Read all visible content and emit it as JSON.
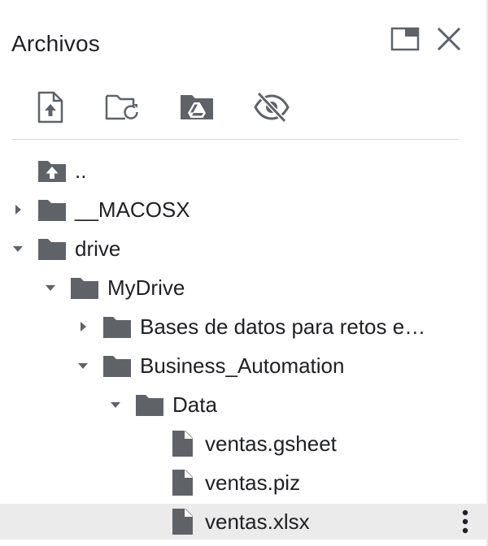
{
  "panel": {
    "title": "Archivos",
    "window_controls": [
      {
        "name": "maximize-icon"
      },
      {
        "name": "close-icon"
      }
    ]
  },
  "toolbar": {
    "buttons": [
      {
        "name": "upload-file-icon"
      },
      {
        "name": "refresh-folder-icon"
      },
      {
        "name": "mount-drive-icon"
      },
      {
        "name": "toggle-hidden-files-icon"
      }
    ]
  },
  "tree": {
    "items": [
      {
        "label": "..",
        "type": "parent-folder",
        "depth": 0,
        "expander": "none"
      },
      {
        "label": "__MACOSX",
        "type": "folder",
        "depth": 0,
        "expander": "collapsed"
      },
      {
        "label": "drive",
        "type": "folder",
        "depth": 0,
        "expander": "expanded"
      },
      {
        "label": "MyDrive",
        "type": "folder",
        "depth": 1,
        "expander": "expanded"
      },
      {
        "label": "Bases de datos para retos e…",
        "type": "folder",
        "depth": 2,
        "expander": "collapsed"
      },
      {
        "label": "Business_Automation",
        "type": "folder",
        "depth": 2,
        "expander": "expanded"
      },
      {
        "label": "Data",
        "type": "folder",
        "depth": 3,
        "expander": "expanded"
      },
      {
        "label": "ventas.gsheet",
        "type": "file",
        "depth": 4,
        "expander": "none"
      },
      {
        "label": "ventas.piz",
        "type": "file",
        "depth": 4,
        "expander": "none"
      },
      {
        "label": "ventas.xlsx",
        "type": "file",
        "depth": 4,
        "expander": "none",
        "selected": true
      }
    ]
  },
  "colors": {
    "icon": "#5f6368",
    "text": "#202124",
    "selected_row": "#ebebeb"
  }
}
